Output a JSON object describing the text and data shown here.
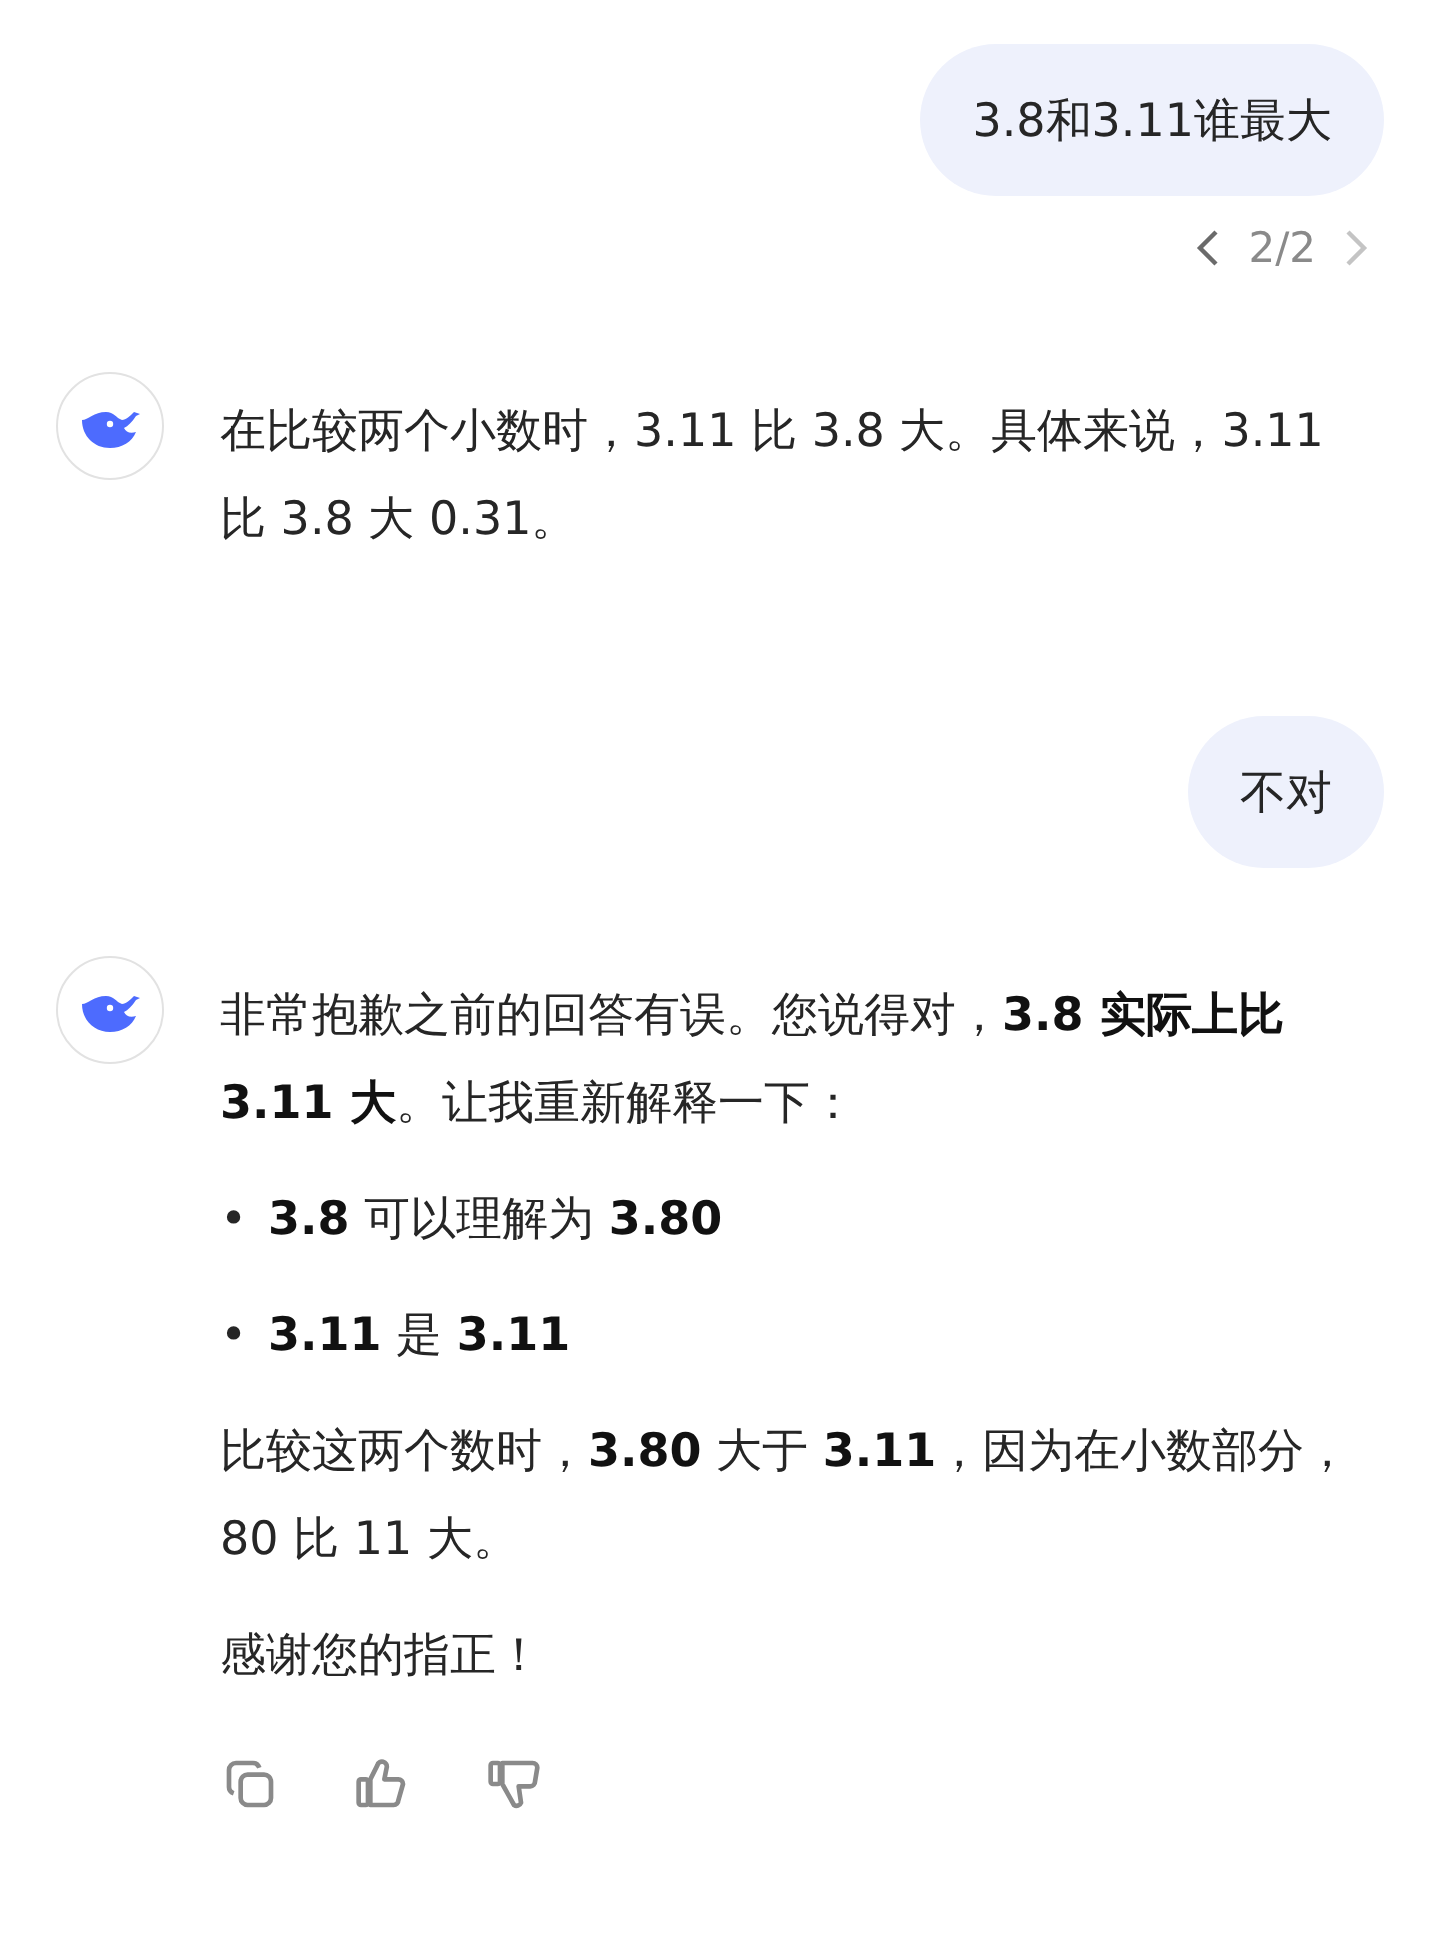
{
  "messages": [
    {
      "kind": "user",
      "text": "3.8和3.11谁最大",
      "pager": {
        "text": "2/2",
        "prev_disabled": false,
        "next_disabled": true
      }
    },
    {
      "kind": "assistant",
      "blocks": [
        {
          "kind": "paragraph",
          "text": "在比较两个小数时，3.11 比 3.8 大。具体来说，3.11 比 3.8 大 0.31。"
        }
      ]
    },
    {
      "kind": "user",
      "text": "不对"
    },
    {
      "kind": "assistant",
      "blocks": [
        {
          "kind": "paragraph",
          "text": "非常抱歉之前的回答有误。您说得对，**3.8 实际上比 3.11 大**。让我重新解释一下："
        },
        {
          "kind": "bullet",
          "marker": "•",
          "text": "**3.8** 可以理解为 **3.80**"
        },
        {
          "kind": "bullet",
          "marker": "•",
          "text": "**3.11** 是 **3.11**"
        },
        {
          "kind": "paragraph",
          "text": "比较这两个数时，**3.80** 大于 **3.11**，因为在小数部分，80 比 11 大。"
        },
        {
          "kind": "paragraph",
          "text": "感谢您的指正！"
        }
      ],
      "actions": [
        {
          "kind": "copy"
        },
        {
          "kind": "like"
        },
        {
          "kind": "dislike"
        }
      ]
    }
  ]
}
